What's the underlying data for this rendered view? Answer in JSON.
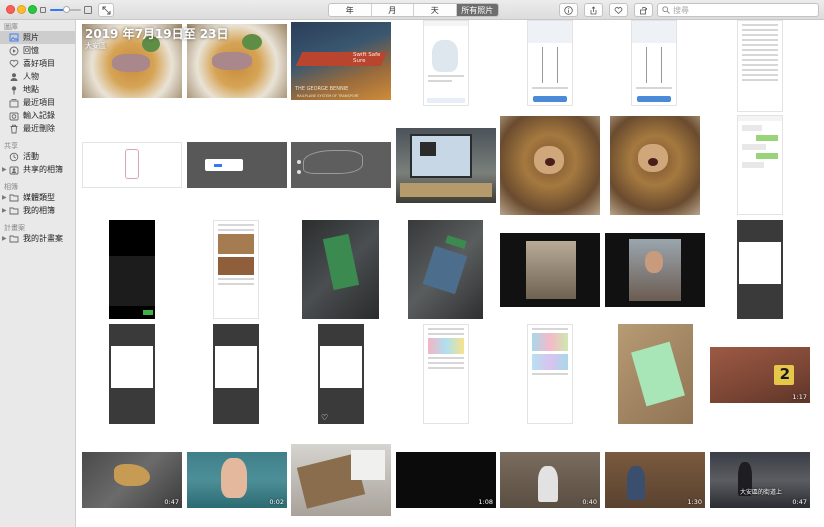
{
  "toolbar": {
    "zoom_level": 0.52,
    "tabs": [
      {
        "label": "年",
        "active": false
      },
      {
        "label": "月",
        "active": false
      },
      {
        "label": "天",
        "active": false
      },
      {
        "label": "所有照片",
        "active": true
      }
    ],
    "search_placeholder": "搜尋",
    "icons": [
      "info-icon",
      "share-icon",
      "heart-icon",
      "rotate-icon"
    ]
  },
  "sidebar": {
    "library_title": "圖庫",
    "library_items": [
      {
        "label": "照片",
        "icon": "photos-icon",
        "selected": true
      },
      {
        "label": "回憶",
        "icon": "memories-icon",
        "selected": false
      },
      {
        "label": "喜好項目",
        "icon": "favorites-icon",
        "selected": false
      },
      {
        "label": "人物",
        "icon": "people-icon",
        "selected": false
      },
      {
        "label": "地點",
        "icon": "places-icon",
        "selected": false
      },
      {
        "label": "最近項目",
        "icon": "recent-icon",
        "selected": false
      },
      {
        "label": "輸入記錄",
        "icon": "imports-icon",
        "selected": false
      },
      {
        "label": "最近刪除",
        "icon": "trash-icon",
        "selected": false
      }
    ],
    "shared_title": "共享",
    "shared_items": [
      {
        "label": "活動",
        "icon": "activity-icon"
      },
      {
        "label": "共享的相簿",
        "icon": "shared-albums-icon"
      }
    ],
    "albums_title": "相簿",
    "album_items": [
      {
        "label": "媒體類型",
        "icon": "folder-icon"
      },
      {
        "label": "我的相簿",
        "icon": "folder-icon"
      }
    ],
    "projects_title": "計畫案",
    "project_items": [
      {
        "label": "我的計畫案",
        "icon": "folder-icon"
      }
    ]
  },
  "moment": {
    "title": "2019 年7月19日至 23日",
    "location": "大安區"
  },
  "tiles": {
    "poster_text": "Swift Safe Sure",
    "poster_caption": "THE GEORGE BENNIE",
    "poster_subcaption": "RAILPLANE SYSTEM OF TRANSPORT",
    "marker_number": "2",
    "video_caption": "大安區的街道上",
    "durations": {
      "brick_video": "1:17",
      "shoe": "0:47",
      "hand": "0:02",
      "dark": "1:08",
      "group": "0:40",
      "cafe": "1:30",
      "street": "0:47"
    }
  },
  "colors": {
    "accent": "#3478f6",
    "sidebar_bg": "#e9e9e9",
    "selected_row": "#cdcdcd",
    "tab_active": "#6e6e6e"
  }
}
